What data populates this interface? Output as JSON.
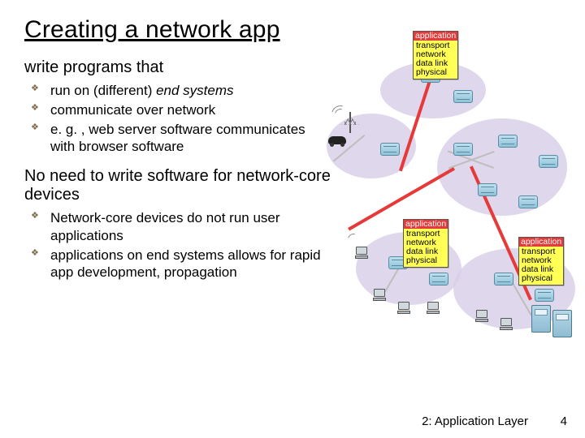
{
  "title": "Creating a network app",
  "section1": {
    "heading": "write programs that",
    "items": [
      {
        "pre": "run on (different) ",
        "em": "end systems"
      },
      {
        "pre": "communicate over network"
      },
      {
        "pre": "e. g. , web server software communicates with browser software"
      }
    ]
  },
  "section2": {
    "heading": "No need to write software for network-core devices",
    "items": [
      {
        "pre": "Network-core devices do not run user applications"
      },
      {
        "pre": "applications on end systems allows for rapid app development, propagation"
      }
    ]
  },
  "stack": {
    "layers": [
      "application",
      "transport",
      "network",
      "data link",
      "physical"
    ],
    "highlight": "application"
  },
  "footer": {
    "chapter": "2: Application Layer",
    "page": "4"
  }
}
